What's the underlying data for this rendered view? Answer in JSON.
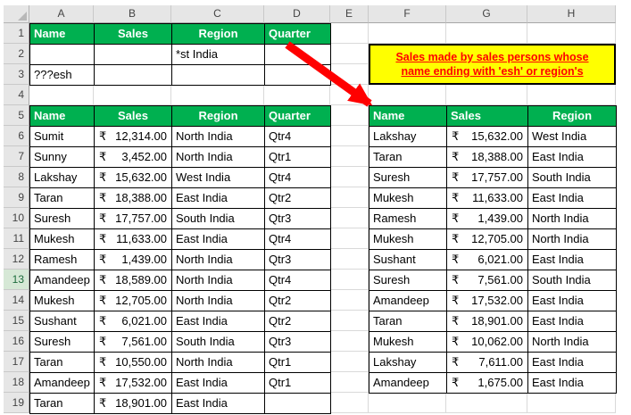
{
  "currency": "₹",
  "colors": {
    "header_green": "#00B050",
    "note_bg": "#FFFF00",
    "note_text": "#FF0000",
    "arrow": "#FF0000",
    "grid": "#D9D9D9"
  },
  "column_headers": [
    "A",
    "B",
    "C",
    "D",
    "E",
    "F",
    "G",
    "H"
  ],
  "row_headers": [
    "1",
    "2",
    "3",
    "4",
    "5",
    "6",
    "7",
    "8",
    "9",
    "10",
    "11",
    "12",
    "13",
    "14",
    "15",
    "16",
    "17",
    "18",
    "19"
  ],
  "criteria": {
    "headers": [
      "Name",
      "Sales",
      "Region",
      "Quarter"
    ],
    "rows": [
      {
        "name": "",
        "sales": "",
        "region": "*st India",
        "quarter": ""
      },
      {
        "name": "???esh",
        "sales": "",
        "region": "",
        "quarter": ""
      }
    ]
  },
  "note": {
    "line1": "Sales made by sales persons whose",
    "line2": "name ending with 'esh' or region's"
  },
  "left_table": {
    "headers": [
      "Name",
      "Sales",
      "Region",
      "Quarter"
    ],
    "rows": [
      {
        "name": "Sumit",
        "sales": "12,314.00",
        "region": "North India",
        "quarter": "Qtr4"
      },
      {
        "name": "Sunny",
        "sales": "3,452.00",
        "region": "North India",
        "quarter": "Qtr1"
      },
      {
        "name": "Lakshay",
        "sales": "15,632.00",
        "region": "West India",
        "quarter": "Qtr4"
      },
      {
        "name": "Taran",
        "sales": "18,388.00",
        "region": "East India",
        "quarter": "Qtr2"
      },
      {
        "name": "Suresh",
        "sales": "17,757.00",
        "region": "South India",
        "quarter": "Qtr3"
      },
      {
        "name": "Mukesh",
        "sales": "11,633.00",
        "region": "East India",
        "quarter": "Qtr4"
      },
      {
        "name": "Ramesh",
        "sales": "1,439.00",
        "region": "North India",
        "quarter": "Qtr3"
      },
      {
        "name": "Amandeep",
        "sales": "18,589.00",
        "region": "North India",
        "quarter": "Qtr4"
      },
      {
        "name": "Mukesh",
        "sales": "12,705.00",
        "region": "North India",
        "quarter": "Qtr2"
      },
      {
        "name": "Sushant",
        "sales": "6,021.00",
        "region": "East India",
        "quarter": "Qtr2"
      },
      {
        "name": "Suresh",
        "sales": "7,561.00",
        "region": "South India",
        "quarter": "Qtr3"
      },
      {
        "name": "Taran",
        "sales": "10,550.00",
        "region": "North India",
        "quarter": "Qtr1"
      },
      {
        "name": "Amandeep",
        "sales": "17,532.00",
        "region": "East India",
        "quarter": "Qtr1"
      },
      {
        "name": "Taran",
        "sales": "18,901.00",
        "region": "East India",
        "quarter": ""
      }
    ]
  },
  "right_table": {
    "headers": [
      "Name",
      "Sales",
      "Region"
    ],
    "rows": [
      {
        "name": "Lakshay",
        "sales": "15,632.00",
        "region": "West India"
      },
      {
        "name": "Taran",
        "sales": "18,388.00",
        "region": "East India"
      },
      {
        "name": "Suresh",
        "sales": "17,757.00",
        "region": "South India"
      },
      {
        "name": "Mukesh",
        "sales": "11,633.00",
        "region": "East India"
      },
      {
        "name": "Ramesh",
        "sales": "1,439.00",
        "region": "North India"
      },
      {
        "name": "Mukesh",
        "sales": "12,705.00",
        "region": "North India"
      },
      {
        "name": "Sushant",
        "sales": "6,021.00",
        "region": "East India"
      },
      {
        "name": "Suresh",
        "sales": "7,561.00",
        "region": "South India"
      },
      {
        "name": "Amandeep",
        "sales": "17,532.00",
        "region": "East India"
      },
      {
        "name": "Taran",
        "sales": "18,901.00",
        "region": "East India"
      },
      {
        "name": "Mukesh",
        "sales": "10,062.00",
        "region": "North India"
      },
      {
        "name": "Lakshay",
        "sales": "7,611.00",
        "region": "East India"
      },
      {
        "name": "Amandeep",
        "sales": "1,675.00",
        "region": "East India"
      }
    ]
  }
}
